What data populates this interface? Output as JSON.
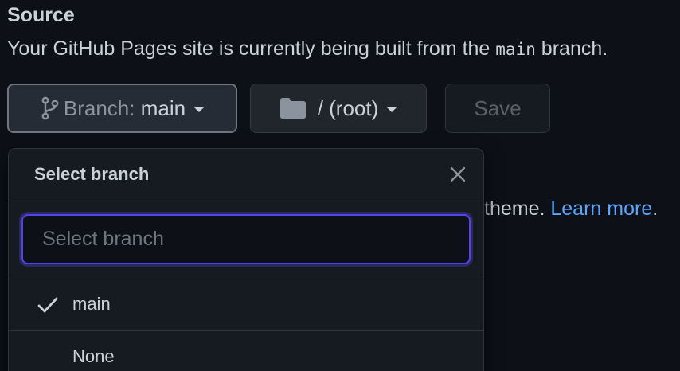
{
  "source": {
    "heading": "Source",
    "description_before": "Your GitHub Pages site is currently being built from the ",
    "description_branch": "main",
    "description_after": " branch."
  },
  "branch_button": {
    "icon": "git-branch-icon",
    "prefix": "Branch: ",
    "value": "main"
  },
  "folder_button": {
    "icon": "folder-icon",
    "label": "/ (root)"
  },
  "save_button": {
    "label": "Save"
  },
  "background": {
    "theme_text": "theme. ",
    "learn_more": "Learn more",
    "period": "."
  },
  "dropdown": {
    "title": "Select branch",
    "close_icon": "close-icon",
    "filter_placeholder": "Select branch",
    "items": [
      {
        "label": "main",
        "selected": true
      },
      {
        "label": "None",
        "selected": false
      }
    ]
  },
  "colors": {
    "background": "#0d1117",
    "link": "#58a6ff",
    "focus_ring": "#4f46e5"
  }
}
